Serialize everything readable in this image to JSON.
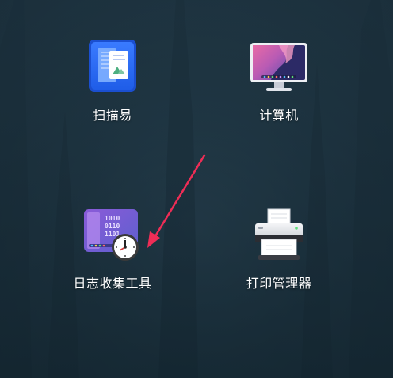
{
  "desktop": {
    "icons": [
      {
        "label": "扫描易",
        "icon": "scanner-document-icon"
      },
      {
        "label": "计算机",
        "icon": "computer-monitor-icon"
      },
      {
        "label": "日志收集工具",
        "icon": "log-collector-clock-icon"
      },
      {
        "label": "打印管理器",
        "icon": "printer-icon"
      }
    ]
  },
  "colors": {
    "background": "#213947",
    "label_text": "#ffffff",
    "annotation_arrow": "#ef2d56"
  }
}
